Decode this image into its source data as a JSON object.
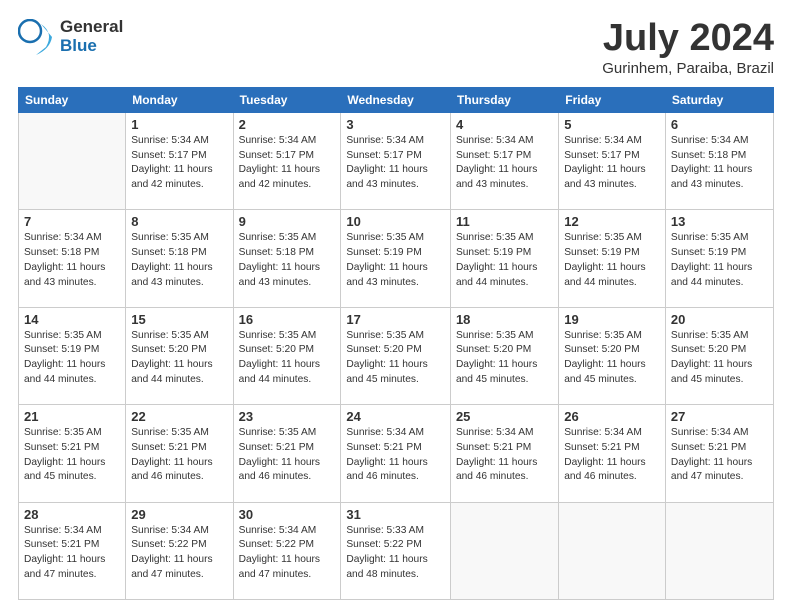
{
  "logo": {
    "general": "General",
    "blue": "Blue"
  },
  "title": {
    "month": "July 2024",
    "location": "Gurinhem, Paraiba, Brazil"
  },
  "weekdays": [
    "Sunday",
    "Monday",
    "Tuesday",
    "Wednesday",
    "Thursday",
    "Friday",
    "Saturday"
  ],
  "weeks": [
    [
      {
        "day": "",
        "info": ""
      },
      {
        "day": "1",
        "info": "Sunrise: 5:34 AM\nSunset: 5:17 PM\nDaylight: 11 hours\nand 42 minutes."
      },
      {
        "day": "2",
        "info": "Sunrise: 5:34 AM\nSunset: 5:17 PM\nDaylight: 11 hours\nand 42 minutes."
      },
      {
        "day": "3",
        "info": "Sunrise: 5:34 AM\nSunset: 5:17 PM\nDaylight: 11 hours\nand 43 minutes."
      },
      {
        "day": "4",
        "info": "Sunrise: 5:34 AM\nSunset: 5:17 PM\nDaylight: 11 hours\nand 43 minutes."
      },
      {
        "day": "5",
        "info": "Sunrise: 5:34 AM\nSunset: 5:17 PM\nDaylight: 11 hours\nand 43 minutes."
      },
      {
        "day": "6",
        "info": "Sunrise: 5:34 AM\nSunset: 5:18 PM\nDaylight: 11 hours\nand 43 minutes."
      }
    ],
    [
      {
        "day": "7",
        "info": "Sunrise: 5:34 AM\nSunset: 5:18 PM\nDaylight: 11 hours\nand 43 minutes."
      },
      {
        "day": "8",
        "info": "Sunrise: 5:35 AM\nSunset: 5:18 PM\nDaylight: 11 hours\nand 43 minutes."
      },
      {
        "day": "9",
        "info": "Sunrise: 5:35 AM\nSunset: 5:18 PM\nDaylight: 11 hours\nand 43 minutes."
      },
      {
        "day": "10",
        "info": "Sunrise: 5:35 AM\nSunset: 5:19 PM\nDaylight: 11 hours\nand 43 minutes."
      },
      {
        "day": "11",
        "info": "Sunrise: 5:35 AM\nSunset: 5:19 PM\nDaylight: 11 hours\nand 44 minutes."
      },
      {
        "day": "12",
        "info": "Sunrise: 5:35 AM\nSunset: 5:19 PM\nDaylight: 11 hours\nand 44 minutes."
      },
      {
        "day": "13",
        "info": "Sunrise: 5:35 AM\nSunset: 5:19 PM\nDaylight: 11 hours\nand 44 minutes."
      }
    ],
    [
      {
        "day": "14",
        "info": "Sunrise: 5:35 AM\nSunset: 5:19 PM\nDaylight: 11 hours\nand 44 minutes."
      },
      {
        "day": "15",
        "info": "Sunrise: 5:35 AM\nSunset: 5:20 PM\nDaylight: 11 hours\nand 44 minutes."
      },
      {
        "day": "16",
        "info": "Sunrise: 5:35 AM\nSunset: 5:20 PM\nDaylight: 11 hours\nand 44 minutes."
      },
      {
        "day": "17",
        "info": "Sunrise: 5:35 AM\nSunset: 5:20 PM\nDaylight: 11 hours\nand 45 minutes."
      },
      {
        "day": "18",
        "info": "Sunrise: 5:35 AM\nSunset: 5:20 PM\nDaylight: 11 hours\nand 45 minutes."
      },
      {
        "day": "19",
        "info": "Sunrise: 5:35 AM\nSunset: 5:20 PM\nDaylight: 11 hours\nand 45 minutes."
      },
      {
        "day": "20",
        "info": "Sunrise: 5:35 AM\nSunset: 5:20 PM\nDaylight: 11 hours\nand 45 minutes."
      }
    ],
    [
      {
        "day": "21",
        "info": "Sunrise: 5:35 AM\nSunset: 5:21 PM\nDaylight: 11 hours\nand 45 minutes."
      },
      {
        "day": "22",
        "info": "Sunrise: 5:35 AM\nSunset: 5:21 PM\nDaylight: 11 hours\nand 46 minutes."
      },
      {
        "day": "23",
        "info": "Sunrise: 5:35 AM\nSunset: 5:21 PM\nDaylight: 11 hours\nand 46 minutes."
      },
      {
        "day": "24",
        "info": "Sunrise: 5:34 AM\nSunset: 5:21 PM\nDaylight: 11 hours\nand 46 minutes."
      },
      {
        "day": "25",
        "info": "Sunrise: 5:34 AM\nSunset: 5:21 PM\nDaylight: 11 hours\nand 46 minutes."
      },
      {
        "day": "26",
        "info": "Sunrise: 5:34 AM\nSunset: 5:21 PM\nDaylight: 11 hours\nand 46 minutes."
      },
      {
        "day": "27",
        "info": "Sunrise: 5:34 AM\nSunset: 5:21 PM\nDaylight: 11 hours\nand 47 minutes."
      }
    ],
    [
      {
        "day": "28",
        "info": "Sunrise: 5:34 AM\nSunset: 5:21 PM\nDaylight: 11 hours\nand 47 minutes."
      },
      {
        "day": "29",
        "info": "Sunrise: 5:34 AM\nSunset: 5:22 PM\nDaylight: 11 hours\nand 47 minutes."
      },
      {
        "day": "30",
        "info": "Sunrise: 5:34 AM\nSunset: 5:22 PM\nDaylight: 11 hours\nand 47 minutes."
      },
      {
        "day": "31",
        "info": "Sunrise: 5:33 AM\nSunset: 5:22 PM\nDaylight: 11 hours\nand 48 minutes."
      },
      {
        "day": "",
        "info": ""
      },
      {
        "day": "",
        "info": ""
      },
      {
        "day": "",
        "info": ""
      }
    ]
  ]
}
